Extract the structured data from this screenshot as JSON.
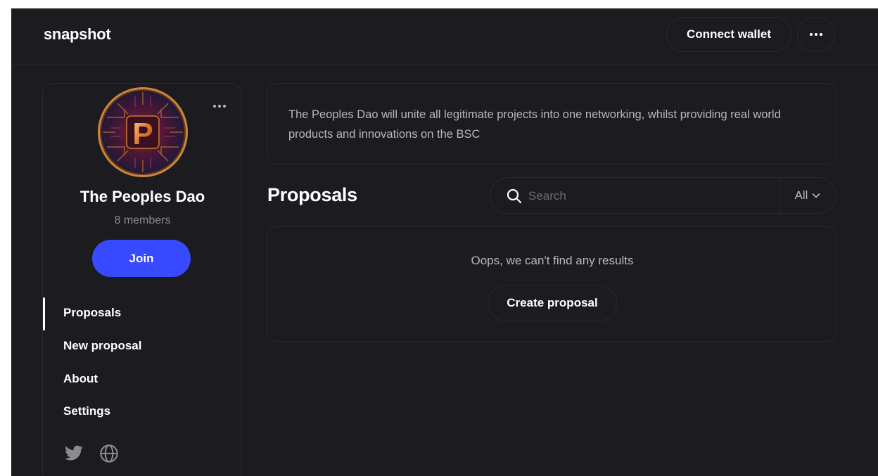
{
  "header": {
    "logo": "snapshot",
    "connect_wallet_label": "Connect wallet",
    "more_icon": "ellipsis-icon"
  },
  "space": {
    "name": "The Peoples Dao",
    "members": "8 members",
    "join_label": "Join",
    "avatar_letter": "P",
    "about": "The Peoples Dao will unite all legitimate projects into one networking, whilst providing real world products and innovations on the BSC"
  },
  "sidebar": {
    "items": [
      {
        "label": "Proposals",
        "active": true
      },
      {
        "label": "New proposal",
        "active": false
      },
      {
        "label": "About",
        "active": false
      },
      {
        "label": "Settings",
        "active": false
      }
    ],
    "social_icons": [
      "twitter-icon",
      "globe-icon"
    ]
  },
  "main": {
    "title": "Proposals",
    "search": {
      "placeholder": "Search",
      "value": ""
    },
    "filter": {
      "selected": "All"
    },
    "empty_message": "Oops, we can't find any results",
    "create_proposal_label": "Create proposal"
  },
  "colors": {
    "background": "#1c1b20",
    "border": "#2a292e",
    "accent": "#384aff",
    "text_primary": "#ffffff",
    "text_secondary": "#8b8a90"
  }
}
